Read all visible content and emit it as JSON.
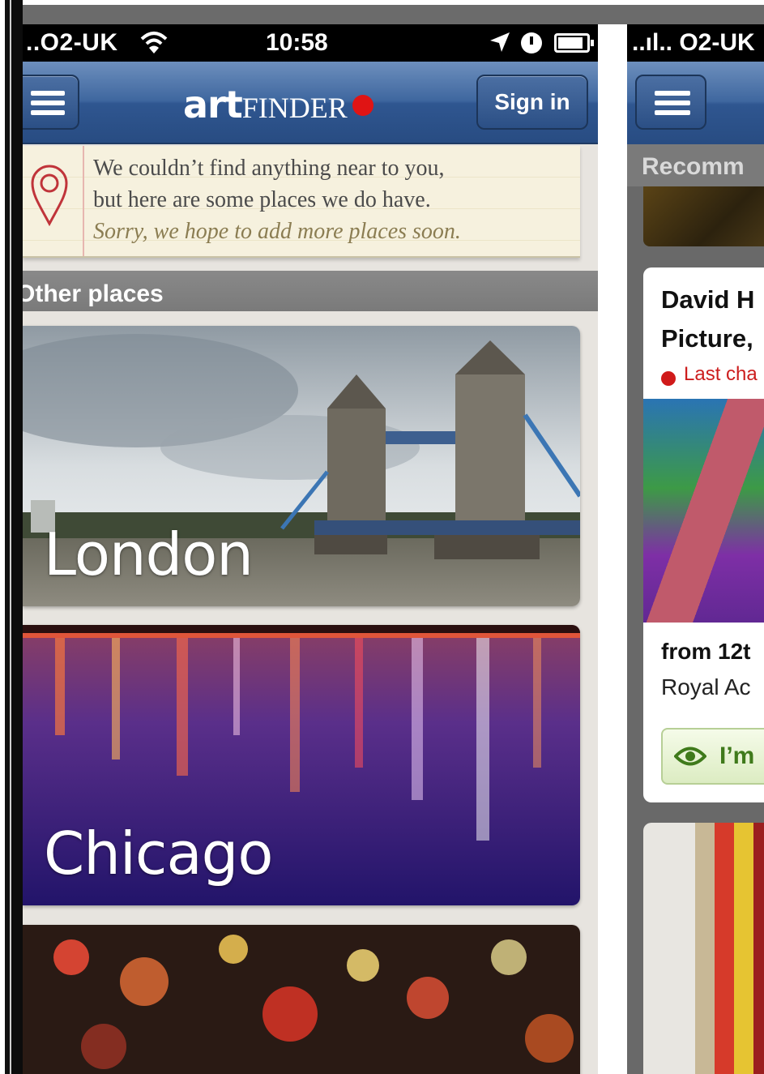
{
  "left_screen": {
    "status_bar": {
      "carrier": "..O2-UK",
      "time": "10:58"
    },
    "nav": {
      "logo_art": "art",
      "logo_finder": "FINDER",
      "sign_in_label": "Sign in"
    },
    "notice": {
      "line1": "We couldn’t find anything near to you,",
      "line2": "but here are some places we do have.",
      "line3": "Sorry, we hope to add more places soon."
    },
    "section_title": "Other places",
    "places": [
      {
        "name": "London"
      },
      {
        "name": "Chicago"
      },
      {
        "name": ""
      }
    ]
  },
  "right_screen": {
    "status_bar": {
      "carrier": "..ıl.. O2-UK"
    },
    "section_title": "Recomm",
    "event": {
      "title_line1": "David H",
      "title_line2": "Picture,",
      "badge": "Last cha",
      "date": "from 12t",
      "venue": "Royal Ac",
      "going_label": "I’m"
    }
  },
  "colors": {
    "nav_blue": "#2f5690",
    "logo_dot": "#e01414",
    "notice_paper": "#f6f1de",
    "badge_red": "#cc1d1d",
    "going_green": "#3f7a1b"
  }
}
